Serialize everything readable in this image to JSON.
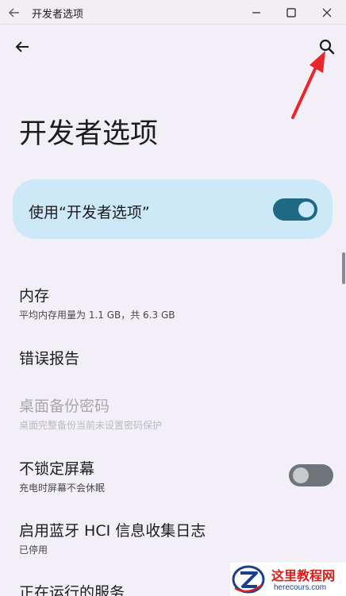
{
  "window": {
    "title": "开发者选项",
    "back_icon": "arrow-left-icon",
    "minimize_icon": "minimize-icon",
    "maximize_icon": "maximize-icon",
    "close_icon": "close-icon"
  },
  "toolbar": {
    "back_icon": "arrow-left-icon",
    "search_icon": "search-icon"
  },
  "page": {
    "title": "开发者选项"
  },
  "main_toggle": {
    "label": "使用“开发者选项”",
    "checked": true
  },
  "items": [
    {
      "title": "内存",
      "subtitle": "平均内存用量为 1.1 GB，共 6.3 GB"
    },
    {
      "title": "错误报告"
    },
    {
      "title": "桌面备份密码",
      "subtitle": "桌面完整备份当前未设置密码保护",
      "disabled": true
    },
    {
      "title": "不锁定屏幕",
      "subtitle": "充电时屏幕不会休眠",
      "toggle": false
    },
    {
      "title": "启用蓝牙 HCI 信息收集日志",
      "subtitle": "已停用"
    },
    {
      "title": "正在运行的服务"
    }
  ],
  "watermark": {
    "cn": "这里教程网",
    "en": "herecours.com"
  },
  "colors": {
    "background": "#f2f0f6",
    "card": "#cde9f8",
    "switch_on": "#1e6985",
    "annotation_arrow": "#e8262b"
  }
}
